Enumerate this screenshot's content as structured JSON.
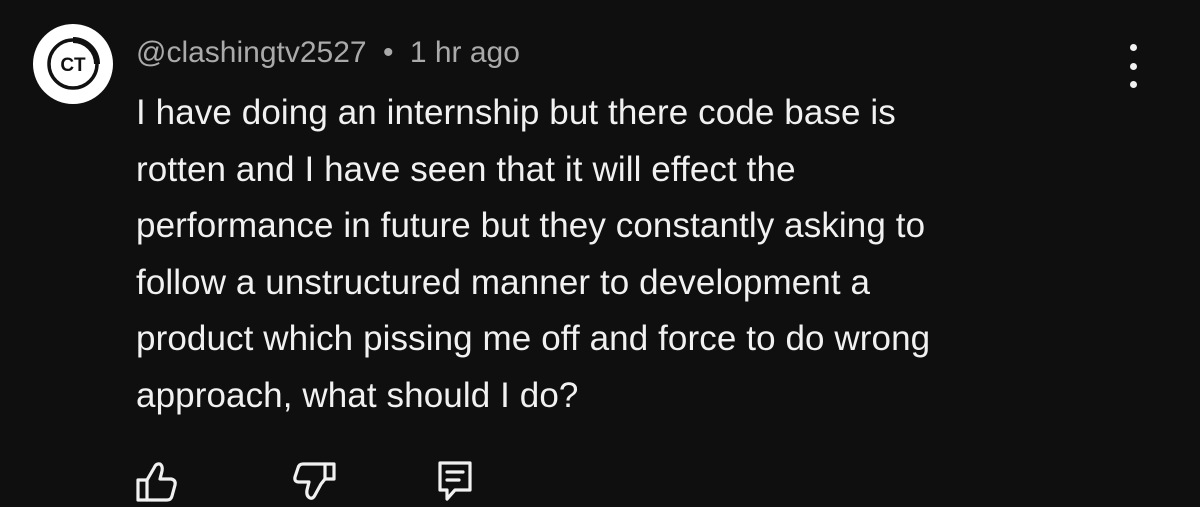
{
  "comment": {
    "avatar_initials": "CT",
    "username": "@clashingtv2527",
    "separator": "•",
    "timestamp": "1 hr ago",
    "body_lines": [
      "I have doing an internship but there code base is",
      "rotten and I have seen that it will effect the",
      "performance in future but they constantly asking to",
      "follow a unstructured manner to development a",
      "product which pissing me off and force to do wrong",
      "approach, what should I do?"
    ]
  },
  "actions": {
    "like_icon": "thumbs-up-icon",
    "dislike_icon": "thumbs-down-icon",
    "reply_icon": "reply-comment-icon",
    "more_icon": "more-vertical-icon"
  },
  "colors": {
    "background": "#0f0f0f",
    "text": "#f1f1f1",
    "meta_text": "#aaaaaa",
    "avatar_bg": "#ffffff"
  }
}
